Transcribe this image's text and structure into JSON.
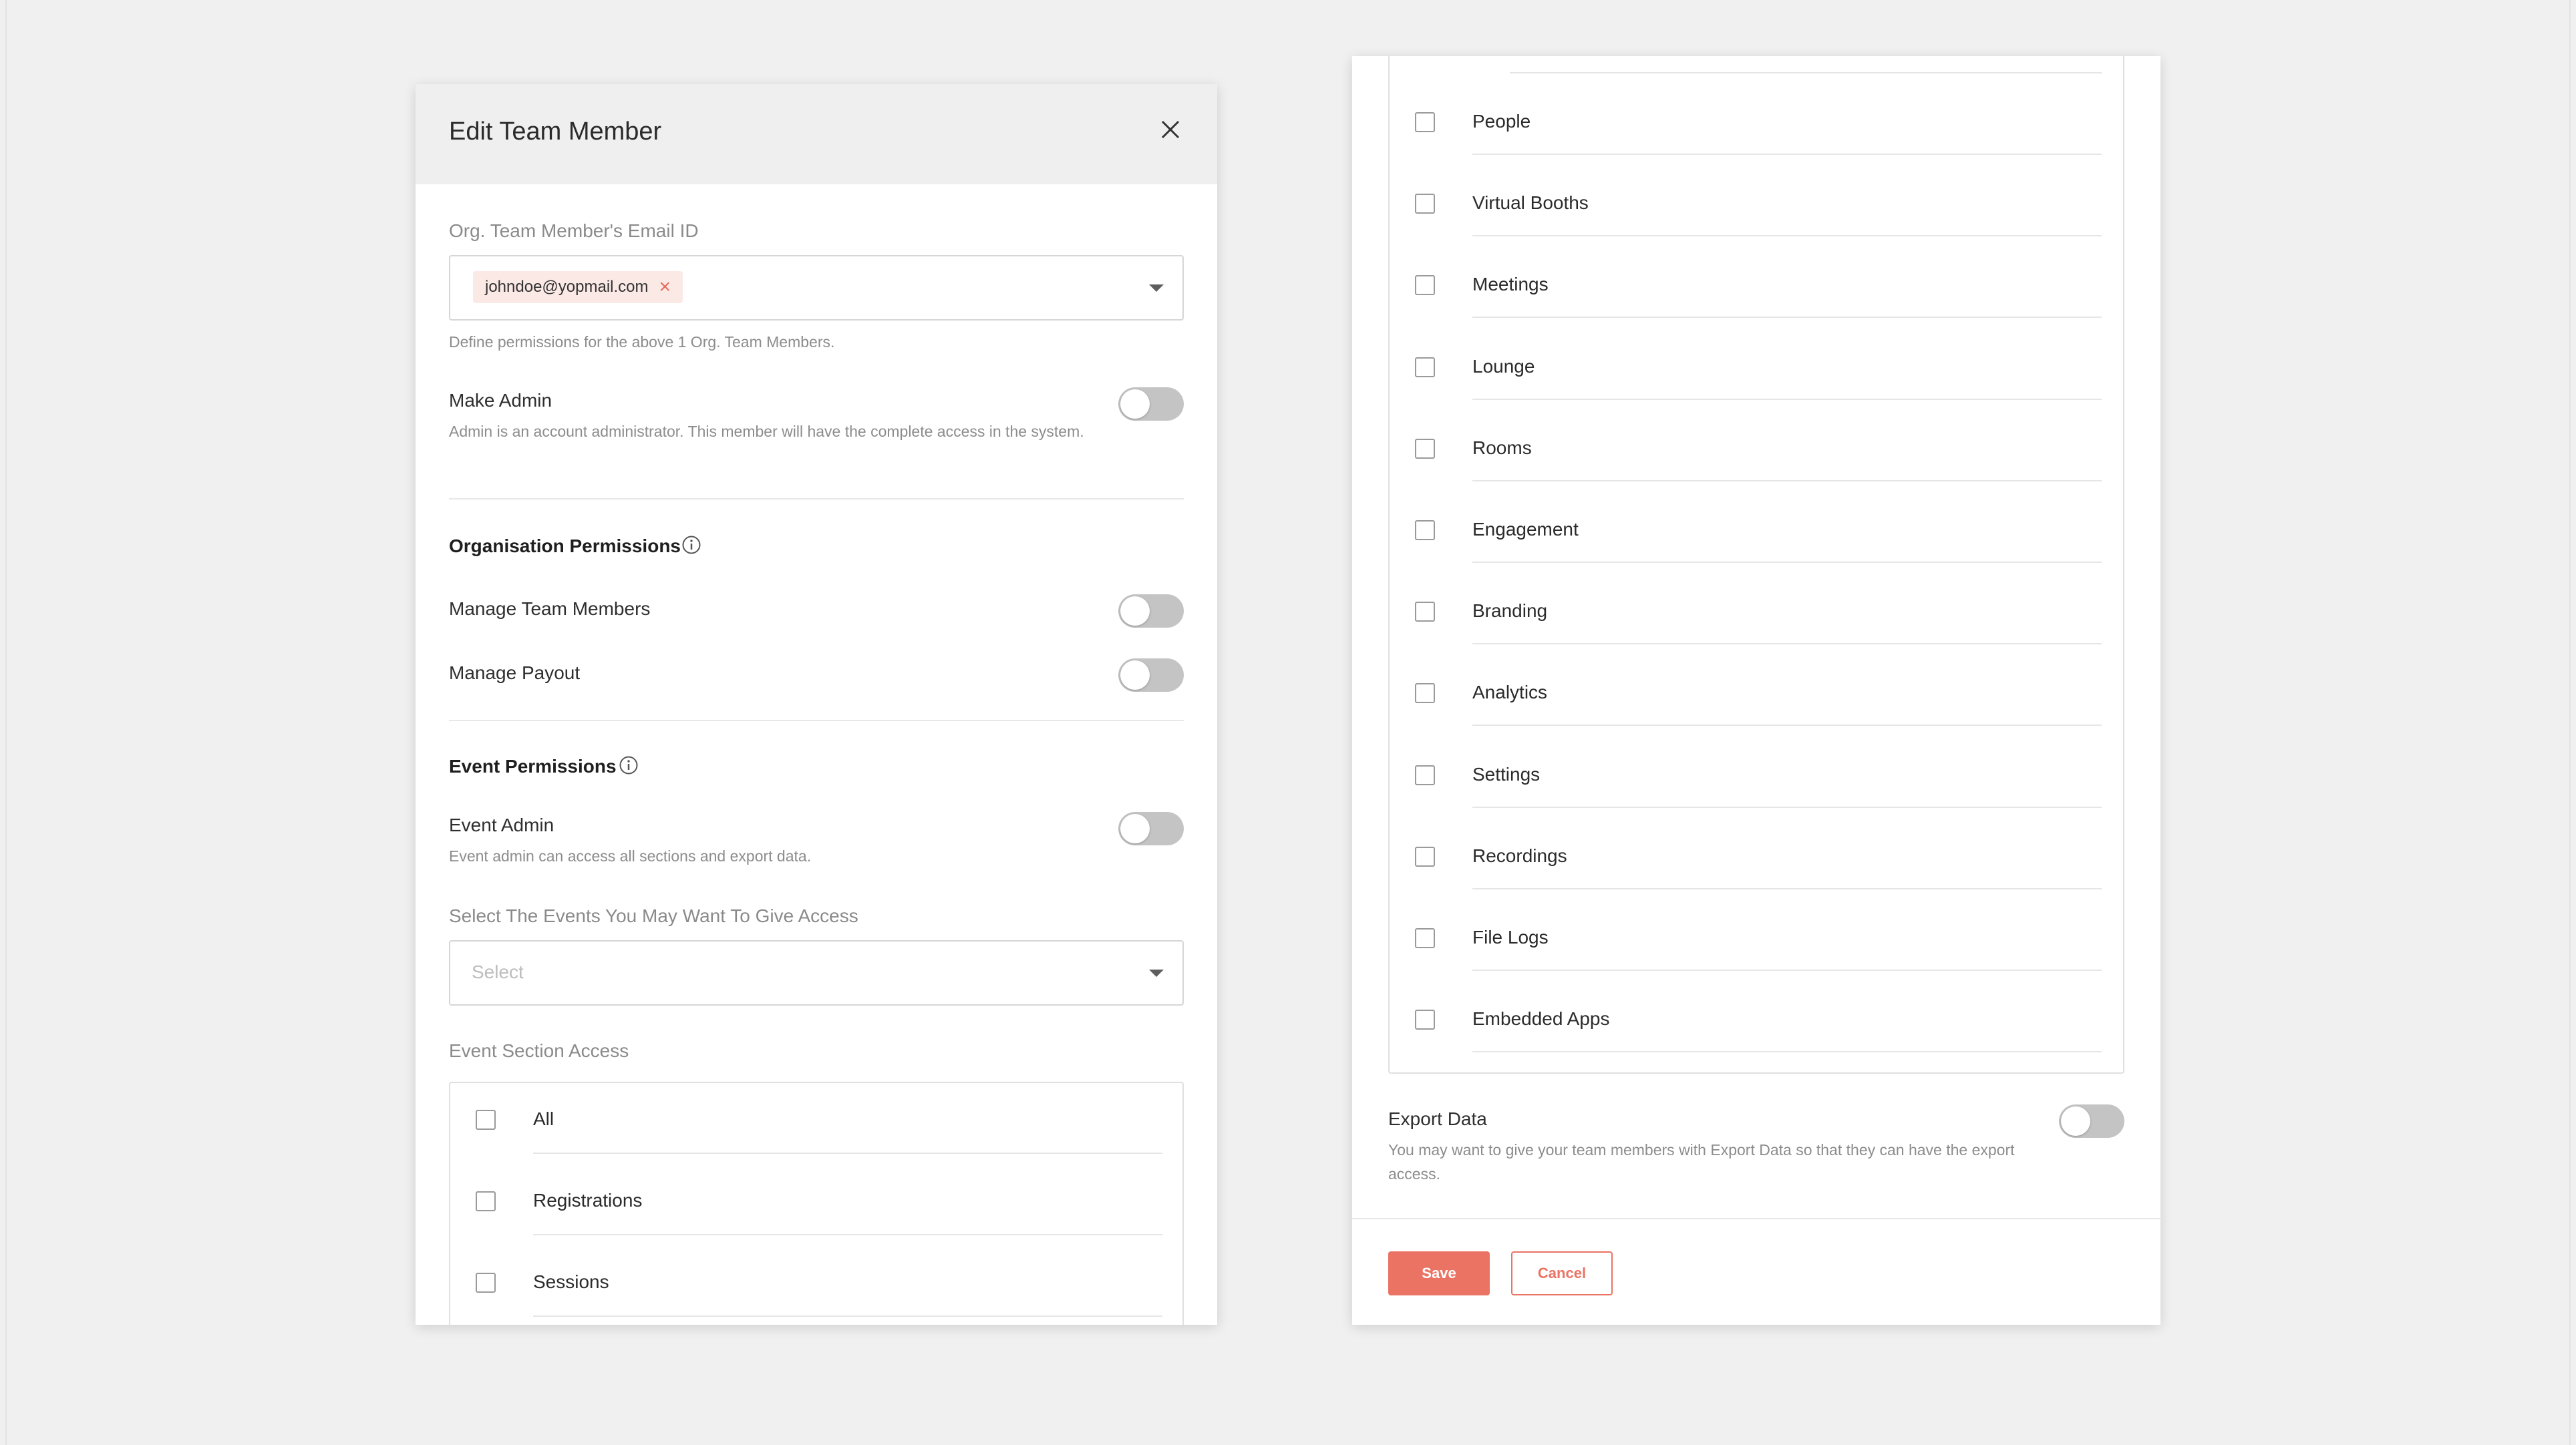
{
  "modal": {
    "title": "Edit Team Member",
    "email_label": "Org. Team Member's Email ID",
    "email_chip": "johndoe@yopmail.com",
    "email_help": "Define permissions for the above 1 Org. Team Members.",
    "make_admin": {
      "label": "Make Admin",
      "help": "Admin is an account administrator. This member will have the complete access in the system.",
      "enabled": false
    },
    "org_permissions": {
      "title": "Organisation Permissions",
      "items": [
        {
          "label": "Manage Team Members",
          "enabled": false
        },
        {
          "label": "Manage Payout",
          "enabled": false
        }
      ]
    },
    "event_permissions": {
      "title": "Event Permissions",
      "event_admin": {
        "label": "Event Admin",
        "help": "Event admin can access all sections and export data.",
        "enabled": false
      },
      "select_events_label": "Select The Events You May Want To Give Access",
      "select_placeholder": "Select",
      "section_access_label": "Event Section Access",
      "sections_left": [
        "All",
        "Registrations",
        "Sessions"
      ],
      "sections_right": [
        "People",
        "Virtual Booths",
        "Meetings",
        "Lounge",
        "Rooms",
        "Engagement",
        "Branding",
        "Analytics",
        "Settings",
        "Recordings",
        "File Logs",
        "Embedded Apps"
      ]
    },
    "export_data": {
      "label": "Export Data",
      "help": "You may want to give your team members with Export Data so that they can have the export access.",
      "enabled": false
    },
    "footer": {
      "save_label": "Save",
      "cancel_label": "Cancel"
    }
  },
  "colors": {
    "accent": "#eb7364",
    "toggle_off": "#c4c4c4",
    "header_bg": "#efefef"
  }
}
